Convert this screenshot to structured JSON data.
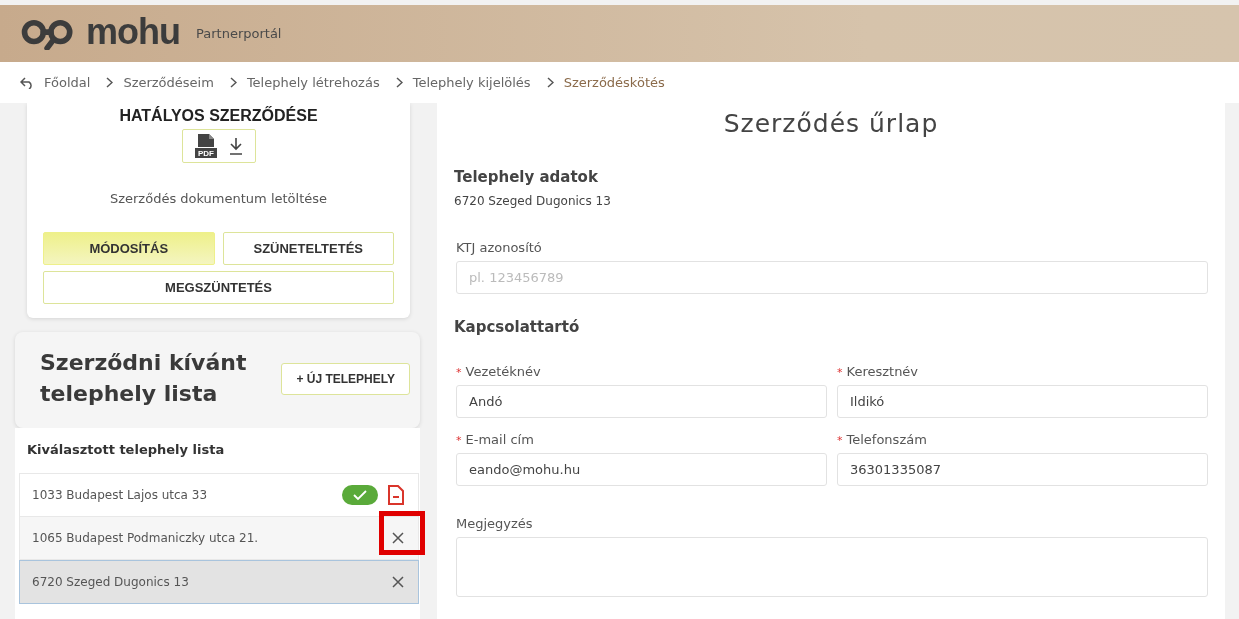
{
  "header": {
    "logo": "mohu",
    "subtitle": "Partnerportál"
  },
  "breadcrumb": [
    "Főoldal",
    "Szerződéseim",
    "Telephely létrehozás",
    "Telephely kijelölés",
    "Szerződéskötés"
  ],
  "contract_card": {
    "title": "HATÁLYOS SZERZŐDÉSE",
    "pdf_label": "PDF",
    "download_label": "Szerződés dokumentum letöltése",
    "buttons": [
      {
        "label": "MÓDOSÍTÁS",
        "selected": true
      },
      {
        "label": "SZÜNETELTETÉS",
        "selected": false
      },
      {
        "label": "MEGSZÜNTETÉS",
        "selected": false
      }
    ]
  },
  "site_list": {
    "title": "Szerződni kívánt telephely lista",
    "new_button": "+ ÚJ TELEPHELY",
    "subtitle": "Kiválasztott telephely lista",
    "rows": [
      {
        "address": "1033 Budapest Lajos utca 33",
        "kind": "signed",
        "selected": false,
        "highlighted": false
      },
      {
        "address": "1065 Budapest Podmaniczky utca 21.",
        "kind": "removable",
        "selected": false,
        "highlighted": true
      },
      {
        "address": "6720 Szeged Dugonics 13",
        "kind": "removable",
        "selected": true,
        "highlighted": false
      }
    ]
  },
  "form": {
    "title": "Szerződés űrlap",
    "site_heading": "Telephely adatok",
    "site_address": "6720 Szeged Dugonics 13",
    "ktj": {
      "label": "KTJ azonosító",
      "placeholder": "pl. 123456789"
    },
    "contact_heading": "Kapcsolattartó",
    "fields": [
      {
        "label": "Vezetéknév",
        "value": "Andó",
        "required_mark": "*"
      },
      {
        "label": "Keresztnév",
        "value": "Ildikó",
        "required_mark": "*"
      },
      {
        "label": "E-mail cím",
        "value": "eando@mohu.hu",
        "required_mark": "*"
      },
      {
        "label": "Telefonszám",
        "value": "36301335087",
        "required_mark": "*"
      }
    ],
    "note": {
      "label": "Megjegyzés"
    }
  }
}
